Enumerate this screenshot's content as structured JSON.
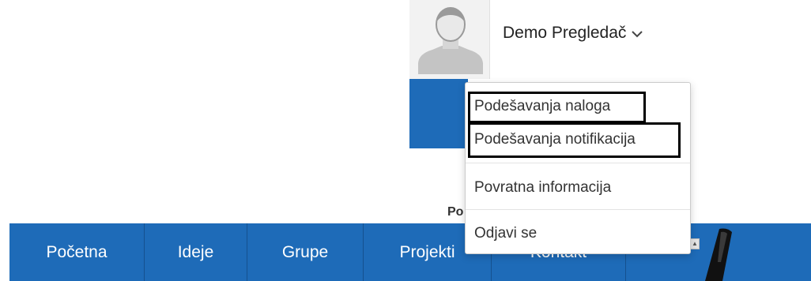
{
  "header": {
    "avatar_icon": "user-placeholder-icon",
    "user_name": "Demo Pregledač",
    "chevron_icon": "chevron-down-icon"
  },
  "user_dropdown": {
    "items": [
      {
        "label": "Podešavanja naloga"
      },
      {
        "label": "Podešavanja notifikacija"
      },
      {
        "label": "Povratna informacija"
      },
      {
        "label": "Odjavi se"
      }
    ]
  },
  "page": {
    "partial_label": "Po"
  },
  "nav": {
    "items": [
      {
        "label": "Početna"
      },
      {
        "label": "Ideje"
      },
      {
        "label": "Grupe"
      },
      {
        "label": "Projekti"
      },
      {
        "label": "Kontakt"
      }
    ]
  },
  "colors": {
    "nav_background": "#1e6bb8",
    "highlight_border": "#000000"
  }
}
